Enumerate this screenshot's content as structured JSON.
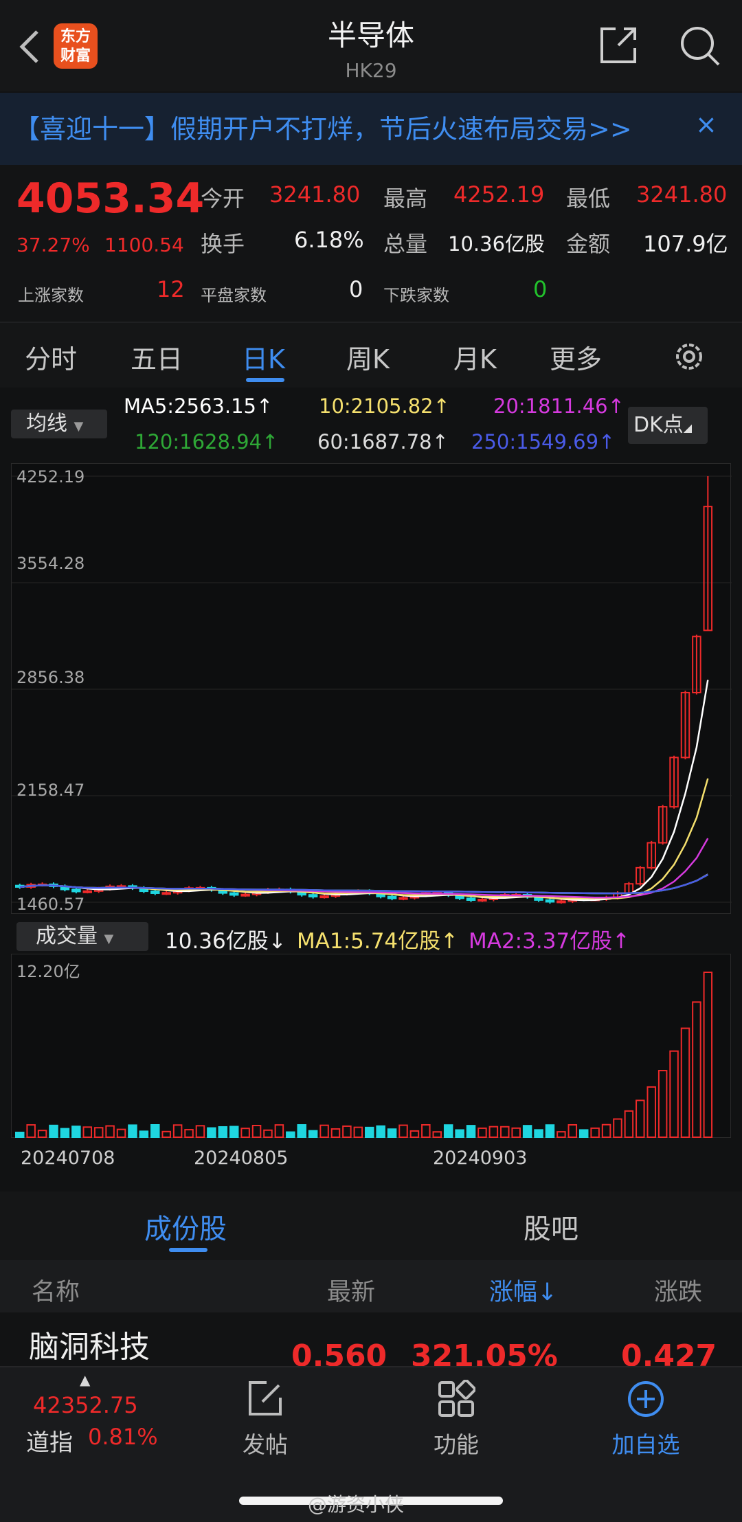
{
  "header": {
    "logo_text": "东方财富",
    "title": "半导体",
    "code": "HK29"
  },
  "banner": {
    "text": "【喜迎十一】假期开户不打烊，节后火速布局交易>>",
    "close": "×"
  },
  "quote": {
    "price": "4053.34",
    "change_pct": "37.27%",
    "change": "1100.54",
    "open_label": "今开",
    "open": "3241.80",
    "high_label": "最高",
    "high": "4252.19",
    "low_label": "最低",
    "low": "3241.80",
    "turnover_label": "换手",
    "turnover": "6.18%",
    "volume_label": "总量",
    "volume": "10.36亿股",
    "amount_label": "金额",
    "amount": "107.9亿",
    "up_label": "上涨家数",
    "up_count": "12",
    "flat_label": "平盘家数",
    "flat_count": "0",
    "down_label": "下跌家数",
    "down_count": "0"
  },
  "period_tabs": [
    "分时",
    "五日",
    "日K",
    "周K",
    "月K",
    "更多"
  ],
  "active_tab_index": 2,
  "ma_panel": {
    "selector": "均线",
    "ma5": "MA5:2563.15↑",
    "ma10": "10:2105.82↑",
    "ma20": "20:1811.46↑",
    "ma120": "120:1628.94↑",
    "ma60": "60:1687.78↑",
    "ma250": "250:1549.69↑",
    "dk": "DK点"
  },
  "colors": {
    "up": "#ee2a2a",
    "down": "#1fd6e0",
    "ma5": "#ffffff",
    "ma10": "#f5e06e",
    "ma20": "#d63adf",
    "ma60": "#dddddd",
    "ma120": "#2ea836",
    "ma250": "#4a5be8",
    "accent": "#3f8df0"
  },
  "volume_panel": {
    "selector": "成交量",
    "vol": "10.36亿股↓",
    "ma1": "MA1:5.74亿股↑",
    "ma2": "MA2:3.37亿股↑",
    "max_label": "12.20亿"
  },
  "chart_data": {
    "type": "candlestick",
    "y_ticks": [
      "4252.19",
      "3554.28",
      "2856.38",
      "2158.47",
      "1460.57"
    ],
    "ylim": [
      1460.57,
      4252.19
    ],
    "x_labels": [
      "20240708",
      "20240805",
      "20240903"
    ],
    "last_candle": {
      "open": 3241.8,
      "high": 4252.19,
      "low": 3241.8,
      "close": 4053.34
    },
    "volume_max": 12.2,
    "volume_unit": "亿"
  },
  "section_tabs": [
    "成份股",
    "股吧"
  ],
  "list_header": [
    "名称",
    "最新",
    "涨幅↓",
    "涨跌"
  ],
  "rows": [
    {
      "name": "脑洞科技",
      "last": "0.560",
      "pct": "321.05%",
      "chg": "0.427"
    }
  ],
  "bottom_bar": {
    "index_value": "42352.75",
    "index_name": "道指",
    "index_pct": "0.81%",
    "post": "发帖",
    "functions": "功能",
    "add": "加自选"
  },
  "watermark": "@游资小侠"
}
